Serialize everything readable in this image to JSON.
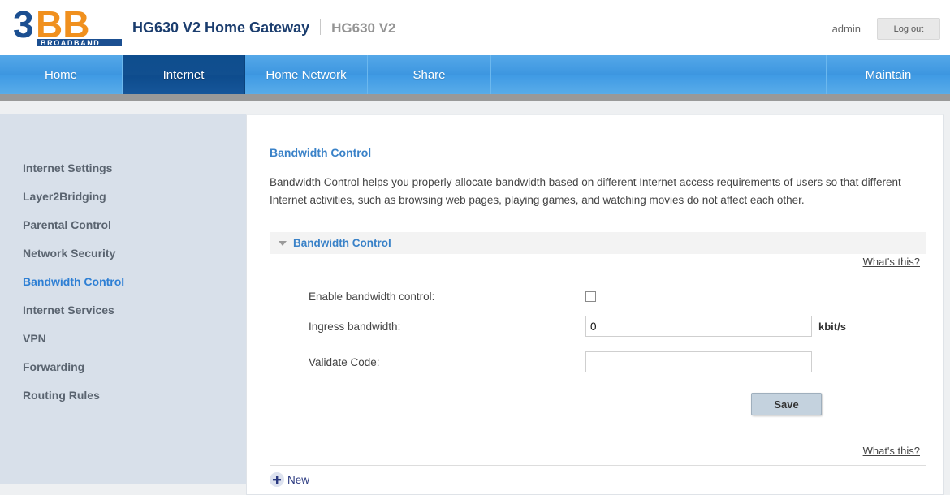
{
  "header": {
    "logo": {
      "mark": "3BB",
      "tagline": "BROADBAND"
    },
    "title": "HG630 V2 Home Gateway",
    "model": "HG630 V2",
    "user": "admin",
    "logout_label": "Log out"
  },
  "nav": {
    "items": [
      {
        "label": "Home",
        "active": false
      },
      {
        "label": "Internet",
        "active": true
      },
      {
        "label": "Home Network",
        "active": false
      },
      {
        "label": "Share",
        "active": false
      },
      {
        "label": "Maintain",
        "active": false
      }
    ]
  },
  "sidebar": {
    "items": [
      {
        "label": "Internet Settings",
        "active": false
      },
      {
        "label": "Layer2Bridging",
        "active": false
      },
      {
        "label": "Parental Control",
        "active": false
      },
      {
        "label": "Network Security",
        "active": false
      },
      {
        "label": "Bandwidth Control",
        "active": true
      },
      {
        "label": "Internet Services",
        "active": false
      },
      {
        "label": "VPN",
        "active": false
      },
      {
        "label": "Forwarding",
        "active": false
      },
      {
        "label": "Routing Rules",
        "active": false
      }
    ]
  },
  "main": {
    "page_title": "Bandwidth Control",
    "description": "Bandwidth Control helps you properly allocate bandwidth based on different Internet access requirements of users so that different Internet activities, such as browsing web pages, playing games, and watching movies do not affect each other.",
    "panel_title": "Bandwidth Control",
    "whats_this_top": "What's this?",
    "whats_this_bottom": "What's this?",
    "fields": {
      "enable_label": "Enable bandwidth control:",
      "enable_checked": false,
      "ingress_label": "Ingress bandwidth:",
      "ingress_value": "0",
      "ingress_unit": "kbit/s",
      "validate_label": "Validate Code:",
      "validate_value": ""
    },
    "save_label": "Save",
    "new_label": "New"
  },
  "colors": {
    "accent_blue": "#3a82c8",
    "nav_blue": "#3d96e0",
    "nav_active": "#0e4d8e",
    "logo_blue": "#1b4f91",
    "logo_orange": "#f0901e",
    "sidebar_bg": "#d8e0ea"
  }
}
